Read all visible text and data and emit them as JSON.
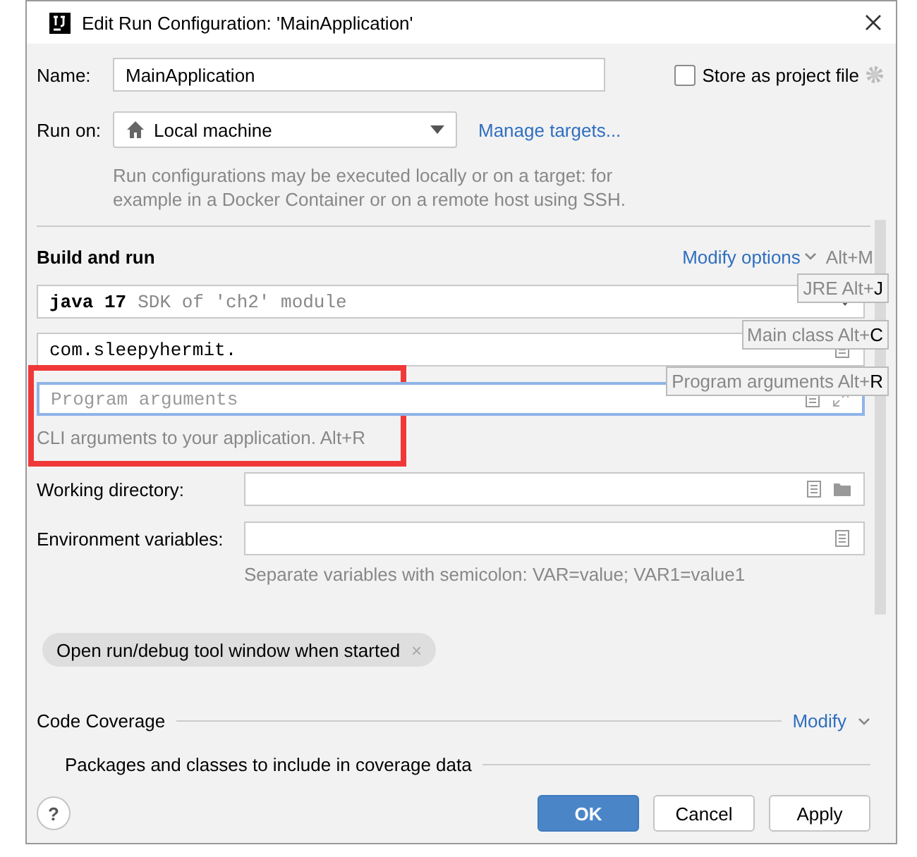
{
  "window": {
    "title": "Edit Run Configuration: 'MainApplication'"
  },
  "name": {
    "label": "Name:",
    "value": "MainApplication"
  },
  "store_as_project_file": {
    "label": "Store as project file",
    "checked": false
  },
  "run_on": {
    "label": "Run on:",
    "value": "Local machine",
    "link": "Manage targets...",
    "hint": "Run configurations may be executed locally or on a target: for example in a Docker Container or on a remote host using SSH."
  },
  "build_and_run": {
    "title": "Build and run",
    "modify_options": "Modify options",
    "shortcut": "Alt+M",
    "jre": {
      "value": "java 17",
      "detail": "SDK of 'ch2' module"
    },
    "main_class": {
      "value": "com.sleepyhermit."
    },
    "program_arguments": {
      "placeholder": "Program arguments",
      "focused": true,
      "highlighted": true,
      "hint": "CLI arguments to your application. Alt+R"
    }
  },
  "shortcut_hints": [
    {
      "label": "JRE Alt+**J**"
    },
    {
      "label": "Main class Alt+**C**"
    },
    {
      "label": "Program arguments Alt+**R**"
    }
  ],
  "working_directory": {
    "label": "Working directory:"
  },
  "environment_variables": {
    "label": "Environment variables:",
    "hint": "Separate variables with semicolon: VAR=value; VAR1=value1"
  },
  "options": [
    {
      "label": "Open run/debug tool window when started",
      "remove": "×"
    }
  ],
  "code_coverage": {
    "title": "Code Coverage",
    "modify": "Modify",
    "packages": "Packages and classes to include in coverage data"
  },
  "help": "?",
  "buttons": [
    {
      "label": "OK",
      "default": true
    },
    {
      "label": "Cancel",
      "default": false
    },
    {
      "label": "Apply",
      "default": false
    }
  ]
}
